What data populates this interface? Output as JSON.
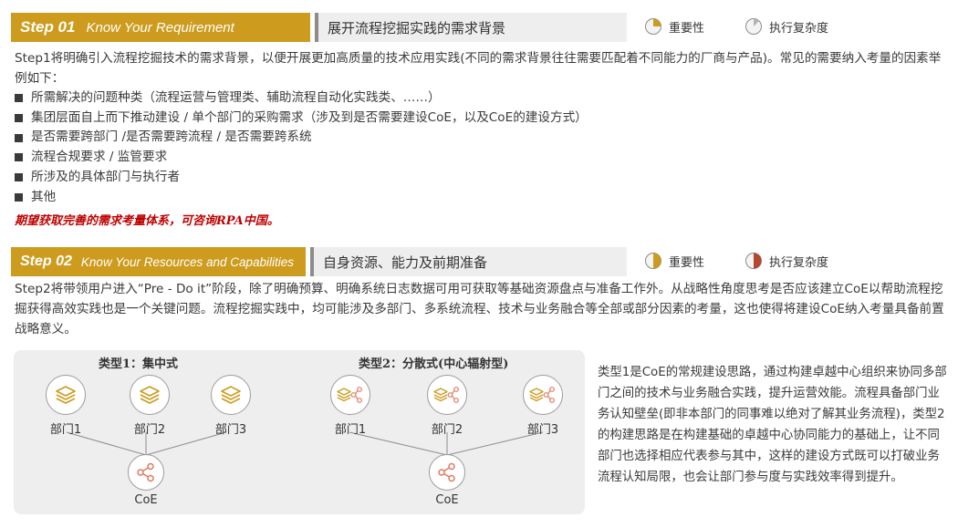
{
  "step1": {
    "number": "Step 01",
    "english_title": "Know Your Requirement",
    "chinese_title": "展开流程挖掘实践的需求背景",
    "importance_label": "重要性",
    "complexity_label": "执行复杂度",
    "importance_level": 0.25,
    "complexity_level": 0.125,
    "paragraph": "Step1将明确引入流程挖掘技术的需求背景，以便开展更加高质量的技术应用实践(不同的需求背景往往需要匹配着不同能力的厂商与产品)。常见的需要纳入考量的因素举例如下：",
    "bullets": [
      "所需解决的问题种类（流程运营与管理类、辅助流程自动化实践类、……）",
      "集团层面自上而下推动建设 / 单个部门的采购需求（涉及到是否需要建设CoE，以及CoE的建设方式）",
      "是否需要跨部门 /是否需要跨流程 / 是否需要跨系统",
      "流程合规要求 / 监管要求",
      "所涉及的具体部门与执行者",
      "其他"
    ],
    "note": "期望获取完善的需求考量体系，可咨询RPA中国。"
  },
  "step2": {
    "number": "Step 02",
    "english_title": "Know Your Resources and Capabilities",
    "chinese_title": "自身资源、能力及前期准备",
    "importance_label": "重要性",
    "complexity_label": "执行复杂度",
    "importance_level": 0.5,
    "complexity_level": 0.5,
    "paragraph": "Step2将带领用户进入“Pre - Do it”阶段，除了明确预算、明确系统日志数据可用可获取等基础资源盘点与准备工作外。从战略性角度思考是否应该建立CoE以帮助流程挖掘获得高效实践也是一个关键问题。流程挖掘实践中，均可能涉及多部门、多系统流程、技术与业务融合等全部或部分因素的考量，这也使得将建设CoE纳入考量具备前置战略意义。"
  },
  "diagram": {
    "type1_title": "类型1：集中式",
    "type2_title": "类型2：分散式(中心辐射型)",
    "dept1": "部门1",
    "dept2": "部门2",
    "dept3": "部门3",
    "coe": "CoE"
  },
  "side_text": "类型1是CoE的常规建设思路，通过构建卓越中心组织来协同多部门之间的技术与业务融合实践，提升运营效能。流程具备部门业务认知壁垒(即非本部门的同事难以绝对了解其业务流程)，类型2的构建思路是在构建基础的卓越中心协同能力的基础上，让不同部门也选择相应代表参与其中，这样的建设方式既可以打破业务流程认知局限，也会让部门参与度与实践效率得到提升。",
  "colors": {
    "gold": "#cd9b1d",
    "dark_gray": "#3a3a3a",
    "note_red": "#c00000",
    "complexity_low": "#b3b3b3",
    "complexity_high": "#b5472e"
  },
  "icons": {
    "layers": "layers-icon",
    "share": "share-nodes-icon",
    "pie": "pie-meter-icon"
  }
}
